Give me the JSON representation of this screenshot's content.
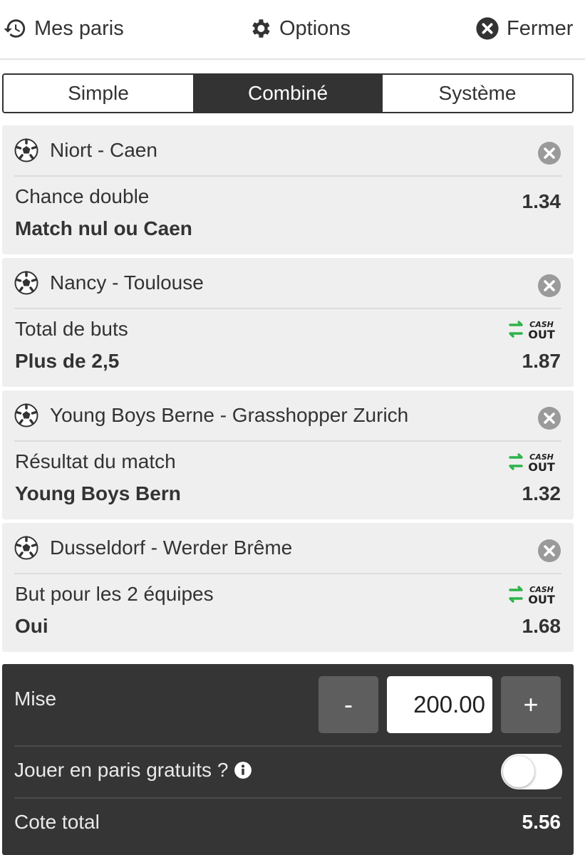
{
  "header": {
    "my_bets_label": "Mes paris",
    "options_label": "Options",
    "close_label": "Fermer"
  },
  "tabs": [
    {
      "label": "Simple",
      "active": false
    },
    {
      "label": "Combiné",
      "active": true
    },
    {
      "label": "Système",
      "active": false
    }
  ],
  "bets": [
    {
      "match": "Niort - Caen",
      "market": "Chance double",
      "selection": "Match nul ou Caen",
      "odds": "1.34",
      "cashout": false,
      "icon": "soccer-ball-icon"
    },
    {
      "match": "Nancy - Toulouse",
      "market": "Total de buts",
      "selection": "Plus de 2,5",
      "odds": "1.87",
      "cashout": true,
      "icon": "soccer-ball-icon"
    },
    {
      "match": "Young Boys Berne - Grasshopper Zurich",
      "market": "Résultat du match",
      "selection": "Young Boys Bern",
      "odds": "1.32",
      "cashout": true,
      "icon": "soccer-ball-icon"
    },
    {
      "match": "Dusseldorf - Werder Brême",
      "market": "But pour les 2 équipes",
      "selection": "Oui",
      "odds": "1.68",
      "cashout": true,
      "icon": "soccer-ball-icon"
    }
  ],
  "stake": {
    "label": "Mise",
    "value": "200.00",
    "minus_label": "-",
    "plus_label": "+"
  },
  "free_bets": {
    "label": "Jouer en paris gratuits ?",
    "enabled": false
  },
  "total_odds": {
    "label": "Cote total",
    "value": "5.56"
  },
  "colors": {
    "dark": "#333333",
    "panel": "#353535",
    "card_bg": "#efefef",
    "cashout_green": "#2db34a"
  }
}
